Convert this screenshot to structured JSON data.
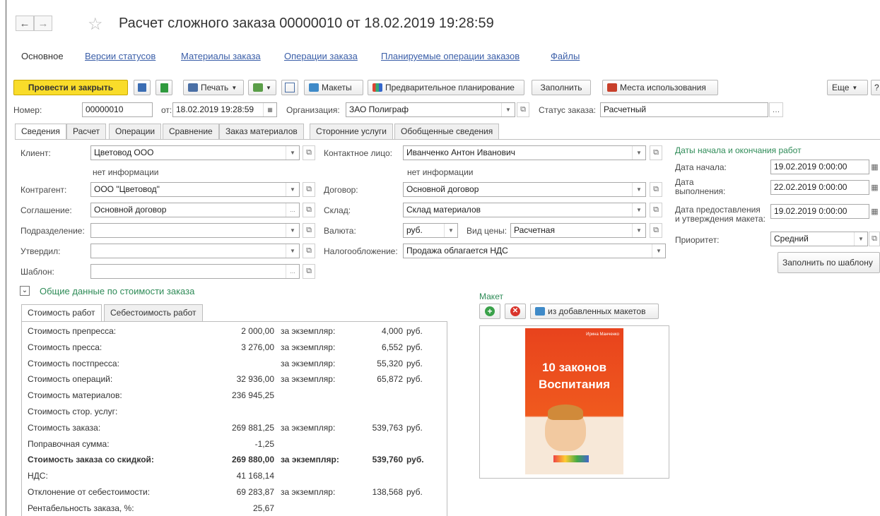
{
  "window": {
    "title": "Расчет сложного заказа 00000010 от 18.02.2019 19:28:59",
    "back_icon": "←",
    "forward_icon": "→"
  },
  "nav_links": [
    "Основное",
    "Версии статусов",
    "Материалы заказа",
    "Операции заказа",
    "Планируемые операции заказов",
    "Файлы"
  ],
  "toolbar": {
    "post_close": "Провести и закрыть",
    "print": "Печать",
    "layouts": "Макеты",
    "preplanning": "Предварительное планирование",
    "fill": "Заполнить",
    "usage_places": "Места использования",
    "more": "Еще",
    "help": "?"
  },
  "header": {
    "number_label": "Номер:",
    "number_value": "00000010",
    "date_label": "от:",
    "date_value": "18.02.2019 19:28:59",
    "org_label": "Организация:",
    "org_value": "ЗАО Полиграф",
    "status_label": "Статус заказа:",
    "status_value": "Расчетный"
  },
  "tabs": [
    "Сведения",
    "Расчет",
    "Операции",
    "Сравнение",
    "Заказ материалов",
    "Сторонние услуги",
    "Обобщенные сведения"
  ],
  "form": {
    "client_label": "Клиент:",
    "client_value": "Цветовод ООО",
    "client_info": "нет информации",
    "contractor_label": "Контрагент:",
    "contractor_value": "ООО \"Цветовод\"",
    "agreement_label": "Соглашение:",
    "agreement_value": "Основной договор",
    "division_label": "Подразделение:",
    "division_value": "",
    "approved_label": "Утвердил:",
    "approved_value": "",
    "template_label": "Шаблон:",
    "template_value": "",
    "contact_label": "Контактное лицо:",
    "contact_value": "Иванченко Антон Иванович",
    "contact_info": "нет информации",
    "contract_label": "Договор:",
    "contract_value": "Основной договор",
    "warehouse_label": "Склад:",
    "warehouse_value": "Склад материалов",
    "currency_label": "Валюта:",
    "currency_value": "руб.",
    "price_type_label": "Вид цены:",
    "price_type_value": "Расчетная",
    "tax_label": "Налогообложение:",
    "tax_value": "Продажа облагается НДС"
  },
  "dates": {
    "heading": "Даты начала и окончания работ",
    "start_label": "Дата начала:",
    "start_value": "19.02.2019  0:00:00",
    "done_label_1": "Дата",
    "done_label_2": "выполнения:",
    "done_value": "22.02.2019  0:00:00",
    "layout_label_1": "Дата предоставления",
    "layout_label_2": "и утверждения макета:",
    "layout_value": "19.02.2019  0:00:00",
    "priority_label": "Приоритет:",
    "priority_value": "Средний",
    "fill_template": "Заполнить по шаблону"
  },
  "cost_section": {
    "heading": "Общие данные по стоимости заказа",
    "subtabs": [
      "Стоимость работ",
      "Себестоимость работ"
    ],
    "per_copy": "за экземпляр:",
    "rub": "руб.",
    "rows": [
      {
        "label": "Стоимость препресса:",
        "value": "2 000,00",
        "per": "4,000",
        "bold": false
      },
      {
        "label": "Стоимость пресса:",
        "value": "3 276,00",
        "per": "6,552",
        "bold": false
      },
      {
        "label": "Стоимость постпресса:",
        "value": "",
        "per": "55,320",
        "bold": false
      },
      {
        "label": "Стоимость операций:",
        "value": "32 936,00",
        "per": "65,872",
        "bold": false
      },
      {
        "label": "Стоимость материалов:",
        "value": "236 945,25",
        "per": "",
        "bold": false
      },
      {
        "label": "Стоимость стор. услуг:",
        "value": "",
        "per": "",
        "bold": false
      },
      {
        "label": "Стоимость заказа:",
        "value": "269 881,25",
        "per": "539,763",
        "bold": false
      },
      {
        "label": "Поправочная сумма:",
        "value": "-1,25",
        "per": "",
        "bold": false
      },
      {
        "label": "Стоимость заказа со скидкой:",
        "value": "269 880,00",
        "per": "539,760",
        "bold": true
      },
      {
        "label": "НДС:",
        "value": "41 168,14",
        "per": "",
        "bold": false
      },
      {
        "label": "Отклонение от себестоимости:",
        "value": "69 283,87",
        "per": "138,568",
        "bold": false
      },
      {
        "label": "Рентабельность заказа, %:",
        "value": "25,67",
        "per": "",
        "bold": false
      }
    ]
  },
  "maket": {
    "heading": "Макет",
    "from_added": "из добавленных макетов",
    "book_author": "Ирина Манченко",
    "book_title_1": "10 законов",
    "book_title_2": "Воспитания"
  }
}
